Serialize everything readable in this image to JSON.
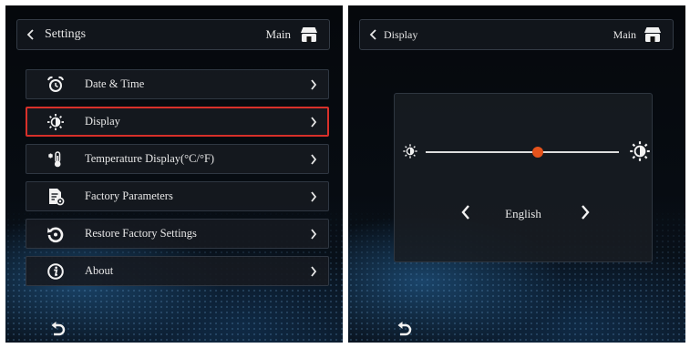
{
  "settings_screen": {
    "header": {
      "title": "Settings",
      "main_label": "Main"
    },
    "menu": [
      {
        "label": "Date & Time",
        "icon": "alarm-clock-icon",
        "selected": false
      },
      {
        "label": "Display",
        "icon": "brightness-icon",
        "selected": true
      },
      {
        "label": "Temperature Display(°C/°F)",
        "icon": "thermometer-icon",
        "selected": false
      },
      {
        "label": "Factory Parameters",
        "icon": "document-settings-icon",
        "selected": false
      },
      {
        "label": "Restore Factory Settings",
        "icon": "restore-icon",
        "selected": false
      },
      {
        "label": "About",
        "icon": "info-icon",
        "selected": false
      }
    ]
  },
  "display_screen": {
    "header": {
      "title": "Display",
      "main_label": "Main"
    },
    "brightness": {
      "level": 0.58
    },
    "language": {
      "value": "English"
    }
  },
  "colors": {
    "highlight_border": "#d8302a",
    "slider_thumb": "#e5531c"
  }
}
